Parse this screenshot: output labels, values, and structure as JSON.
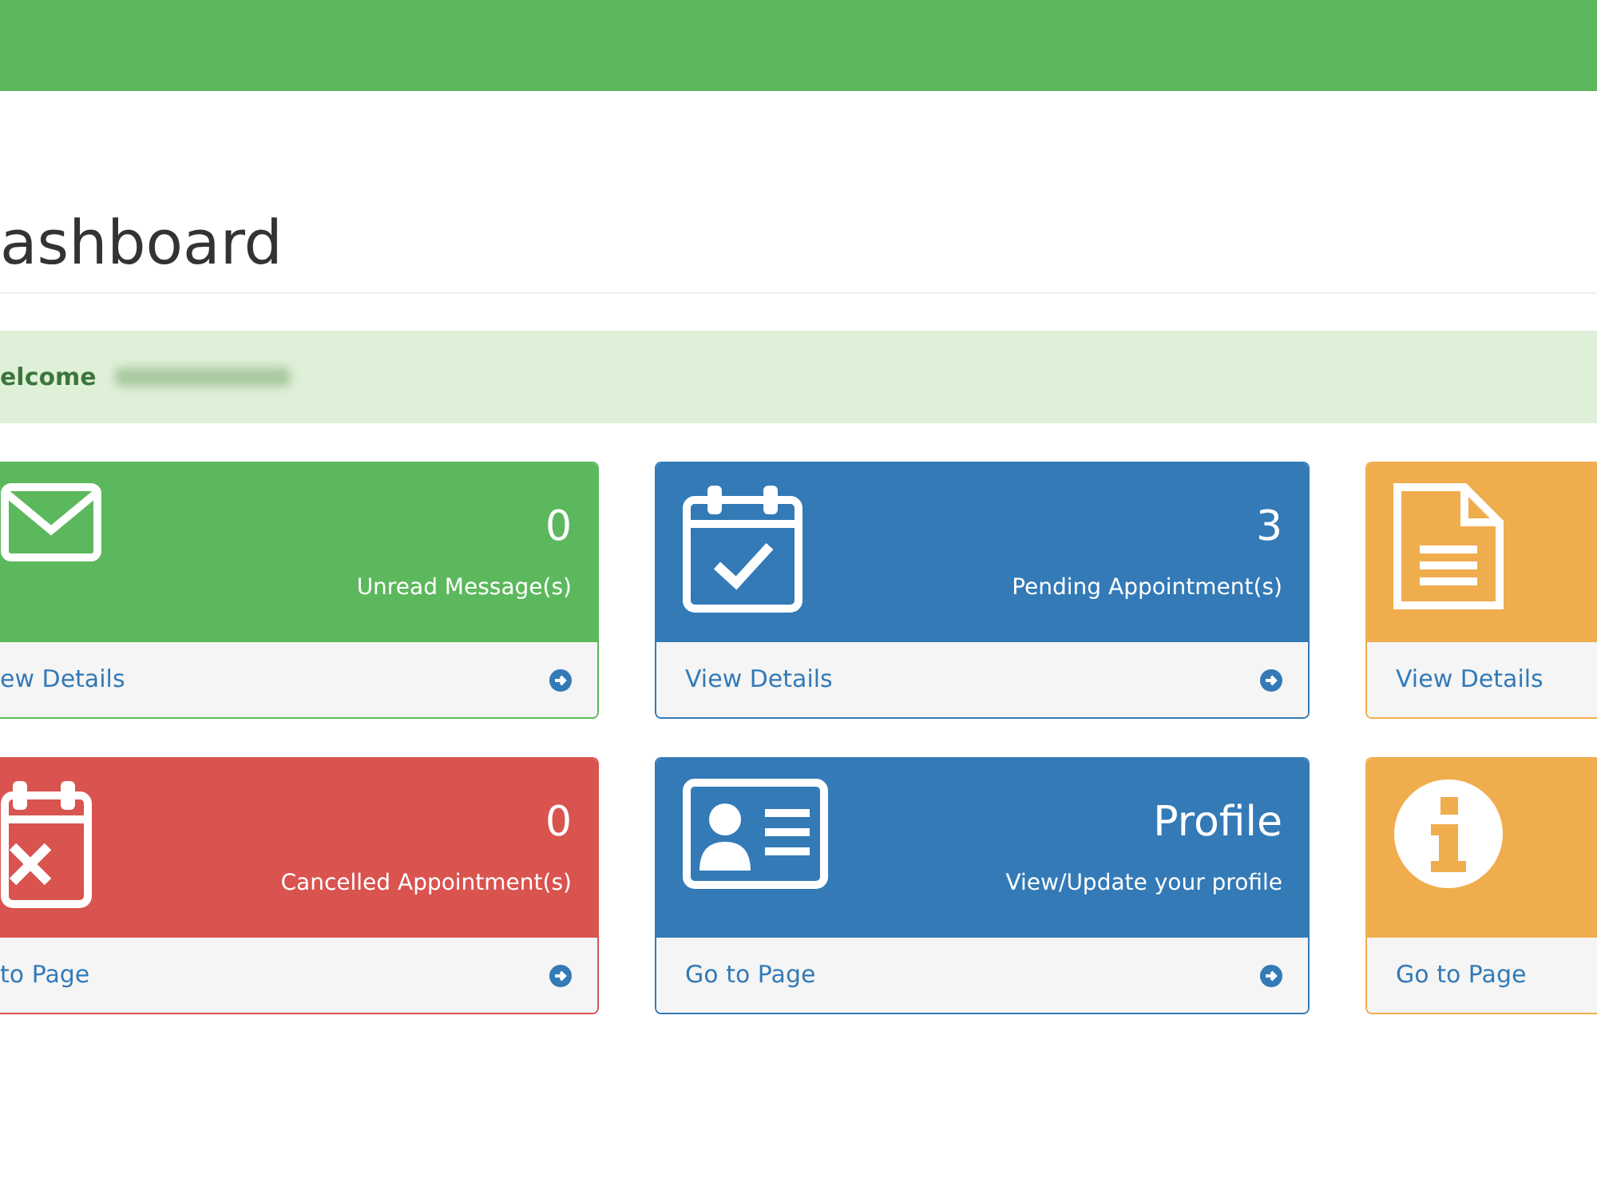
{
  "page_title": "ashboard",
  "welcome": {
    "label": "elcome"
  },
  "panels": [
    {
      "color": "#5cb85c",
      "kind": "envelope",
      "count": "0",
      "caption": "Unread Message(s)",
      "link": "ew Details",
      "arrow": true
    },
    {
      "color": "#337ab7",
      "kind": "calendar-check",
      "count": "3",
      "caption": "Pending Appointment(s)",
      "link": "View Details",
      "arrow": true
    },
    {
      "color": "#f0ad4e",
      "kind": "document",
      "link": "View Details",
      "arrow": false
    },
    {
      "color": "#d9534f",
      "kind": "calendar-x",
      "count": "0",
      "caption": "Cancelled Appointment(s)",
      "link": "to Page",
      "arrow": true
    },
    {
      "color": "#337ab7",
      "kind": "id-card",
      "count": "Profile",
      "caption": "View/Update your profile",
      "link": "Go to Page",
      "arrow": true
    },
    {
      "color": "#f0ad4e",
      "kind": "info",
      "link": "Go to Page",
      "arrow": false
    }
  ]
}
